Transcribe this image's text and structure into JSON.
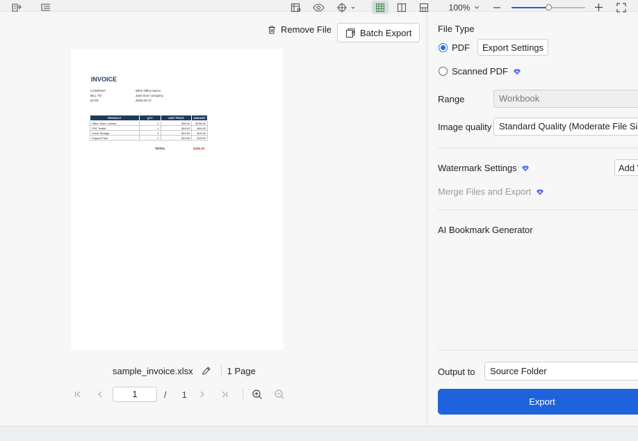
{
  "toolbar": {
    "remove_file_label": "Remove File",
    "batch_export_label": "Batch Export"
  },
  "preview": {
    "invoice_title": "INVOICE",
    "fields": [
      {
        "label": "COMPANY",
        "value": "WPS Office Demo"
      },
      {
        "label": "BILL TO",
        "value": "Jane Doe Company"
      },
      {
        "label": "DATE",
        "value": "2026-03-17"
      }
    ],
    "table_headers": [
      "PRODUCT",
      "QTY",
      "UNIT PRICE",
      "AMOUNT"
    ],
    "table_rows": [
      [
        "Office Suite License",
        "2",
        "$99.00",
        "$198.00"
      ],
      [
        "PDF Toolkit",
        "1",
        "$49.00",
        "$49.00"
      ],
      [
        "Cloud Storage",
        "1",
        "$19.00",
        "$19.00"
      ],
      [
        "Support Plan",
        "1",
        "$19.00",
        "$19.00"
      ]
    ],
    "total_label": "TOTAL",
    "total_value": "$285.00"
  },
  "file": {
    "name": "sample_invoice.xlsx",
    "pages_label": "1 Page"
  },
  "pager": {
    "current_page": "1",
    "separator": "/",
    "total_pages": "1"
  },
  "settings": {
    "file_type_label": "File Type",
    "pdf_label": "PDF",
    "export_settings_label": "Export Settings",
    "scanned_pdf_label": "Scanned PDF",
    "range_label": "Range",
    "range_value": "Workbook",
    "image_quality_label": "Image quality",
    "image_quality_value": "Standard Quality (Moderate File Size)",
    "watermark_label": "Watermark Settings",
    "add_watermark_label": "Add W",
    "merge_label": "Merge Files and Export",
    "ai_bookmark_label": "AI Bookmark Generator",
    "output_to_label": "Output to",
    "output_value": "Source Folder",
    "export_label": "Export"
  },
  "statusbar": {
    "zoom_value": "100%"
  },
  "colors": {
    "accent": "#1f63dc",
    "header_navy": "#1e3a5f",
    "premium_gem": "#5b6cf0"
  }
}
